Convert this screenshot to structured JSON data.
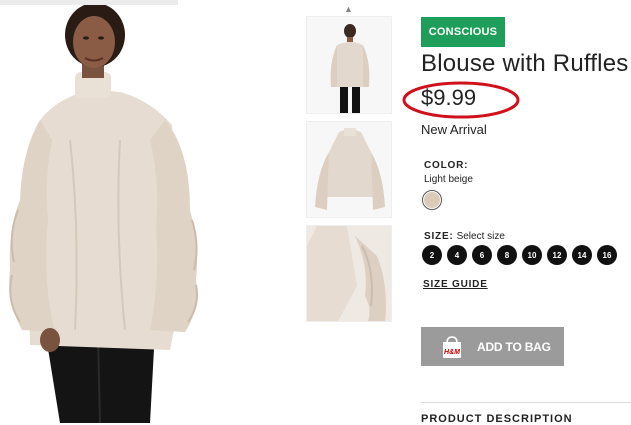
{
  "product": {
    "badge": "CONSCIOUS",
    "title": "Blouse with Ruffles",
    "price": "$9.99",
    "status": "New Arrival"
  },
  "color": {
    "label": "COLOR:",
    "selected": "Light beige",
    "swatch_hex": "#dccab8"
  },
  "size": {
    "label": "SIZE:",
    "hint": "Select size",
    "options": [
      "2",
      "4",
      "6",
      "8",
      "10",
      "12",
      "14",
      "16"
    ]
  },
  "size_guide": "SIZE GUIDE",
  "cart": {
    "add_label": "ADD TO BAG",
    "bag_logo": "H&M",
    "button_color": "#9b9b9b"
  },
  "description_heading": "PRODUCT DESCRIPTION",
  "icons": {
    "thumbnail_scroll_up": "chevron-up-icon",
    "bag": "shopping-bag-icon"
  },
  "colors": {
    "badge": "#1f9e5b",
    "price_ring": "#d0101a",
    "size_button": "#111111"
  }
}
